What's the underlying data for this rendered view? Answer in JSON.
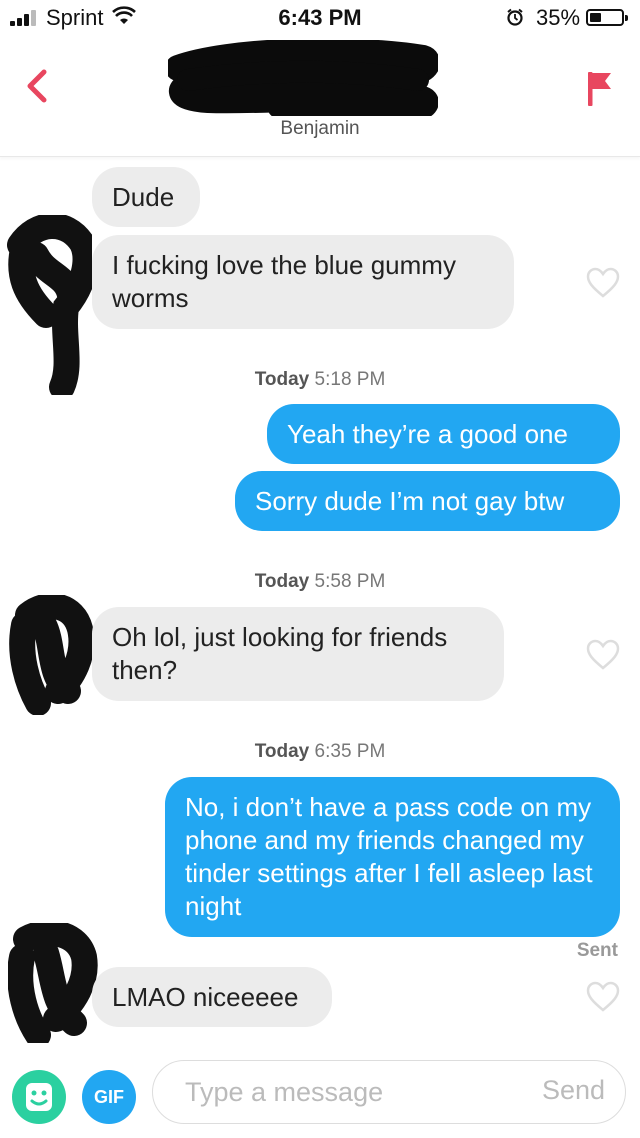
{
  "status_bar": {
    "carrier": "Sprint",
    "time": "6:43 PM",
    "battery": "35%",
    "battery_level": 0.35
  },
  "header": {
    "match_name": "Benjamin",
    "accent_color": "#e8465f"
  },
  "messages": [
    {
      "direction": "in",
      "text": "Dude"
    },
    {
      "direction": "in",
      "text": "I fucking love the blue gummy worms"
    },
    {
      "type": "timestamp",
      "day": "Today",
      "time": "5:18 PM"
    },
    {
      "direction": "out",
      "text": "Yeah they’re a good one"
    },
    {
      "direction": "out",
      "text": "Sorry dude I’m not gay btw"
    },
    {
      "type": "timestamp",
      "day": "Today",
      "time": "5:58 PM"
    },
    {
      "direction": "in",
      "text": "Oh lol, just looking for friends then?"
    },
    {
      "type": "timestamp",
      "day": "Today",
      "time": "6:35 PM"
    },
    {
      "direction": "out",
      "text": "No, i don’t have a pass code on my phone and my friends changed my tinder settings after I fell asleep last night"
    },
    {
      "type": "status",
      "text": "Sent"
    },
    {
      "direction": "in",
      "text": "LMAO niceeeee"
    }
  ],
  "composer": {
    "gif_label": "GIF",
    "placeholder": "Type a message",
    "send_label": "Send",
    "sticker_icon": "sticker-icon"
  },
  "colors": {
    "outgoing_bubble": "#22a7f2",
    "incoming_bubble": "#ececec",
    "sticker_button": "#2bd0a0"
  }
}
